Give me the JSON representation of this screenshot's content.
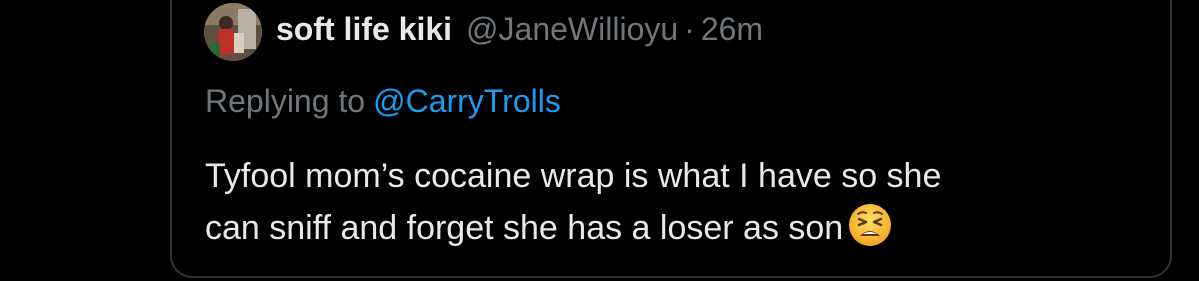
{
  "tweet": {
    "display_name": "soft life kiki",
    "handle": "@JaneWillioyu",
    "separator": "·",
    "timestamp": "26m",
    "replying_to_label": "Replying to",
    "replying_to_handle": "@CarryTrolls",
    "text_line1": "Tyfool mom’s cocaine wrap is what I have so she",
    "text_line2": "can sniff and forget she has a loser as son",
    "emoji_icon": "tired-face-emoji"
  },
  "colors": {
    "background": "#000000",
    "text_primary": "#e7e9ea",
    "text_secondary": "#71767b",
    "link": "#1d9bf0",
    "border": "#2f3336"
  }
}
